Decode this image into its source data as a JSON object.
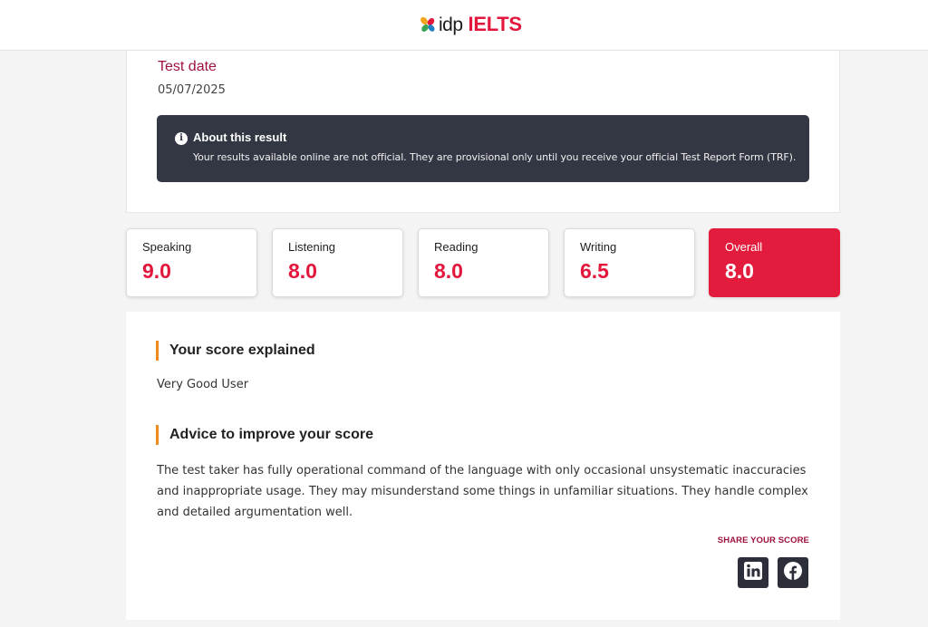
{
  "header": {
    "logo_idp": "idp",
    "logo_ielts": "IELTS"
  },
  "test_info": {
    "date_label": "Test date",
    "date_value": "05/07/2025"
  },
  "about": {
    "icon": "info-icon",
    "title": "About this result",
    "text": "Your results available online are not official. They are provisional only until you receive your official Test Report Form (TRF)."
  },
  "scores": [
    {
      "label": "Speaking",
      "value": "9.0"
    },
    {
      "label": "Listening",
      "value": "8.0"
    },
    {
      "label": "Reading",
      "value": "8.0"
    },
    {
      "label": "Writing",
      "value": "6.5"
    },
    {
      "label": "Overall",
      "value": "8.0"
    }
  ],
  "explained": {
    "heading": "Your score explained",
    "band_description": "Very Good User"
  },
  "advice": {
    "heading": "Advice to improve your score",
    "text": "The test taker has fully operational command of the language with only occasional unsystematic inaccuracies and inappropriate usage. They may misunderstand some things in unfamiliar situations. They handle complex and detailed argumentation well."
  },
  "share": {
    "label": "SHARE YOUR SCORE",
    "buttons": [
      {
        "icon": "linkedin-icon"
      },
      {
        "icon": "facebook-icon"
      }
    ]
  },
  "colors": {
    "brand_red": "#e3163c",
    "maroon": "#a0123e",
    "accent_orange": "#f08a1c",
    "dark_panel": "#333643"
  }
}
